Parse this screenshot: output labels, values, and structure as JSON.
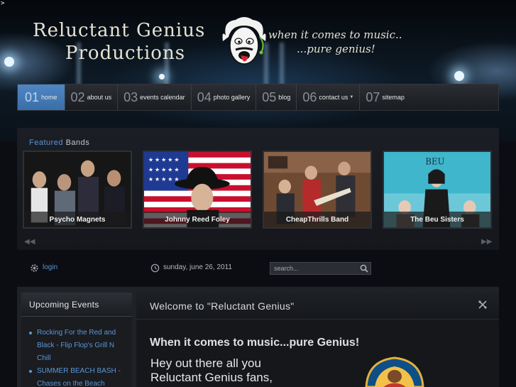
{
  "header": {
    "corner_mark": ">",
    "logo_line1": "Reluctant Genius",
    "logo_line2": "Productions",
    "tagline_line1": "when it comes to music..",
    "tagline_line2": "...pure genius!"
  },
  "nav": {
    "items": [
      {
        "num": "01",
        "label": "home",
        "active": true
      },
      {
        "num": "02",
        "label": "about us"
      },
      {
        "num": "03",
        "label": "events calendar"
      },
      {
        "num": "04",
        "label": "photo gallery"
      },
      {
        "num": "05",
        "label": "blog"
      },
      {
        "num": "06",
        "label": "contact us",
        "has_dropdown": true
      },
      {
        "num": "07",
        "label": "sitemap"
      }
    ]
  },
  "featured": {
    "heading_accent": "Featured",
    "heading_rest": " Bands",
    "bands": [
      {
        "name": "Psycho Magnets"
      },
      {
        "name": "Johnny Reed Foley"
      },
      {
        "name": "CheapThrills Band"
      },
      {
        "name": "The Beu Sisters",
        "sign": "BEU"
      }
    ],
    "prev_arrow": "◀◀",
    "next_arrow": "▶▶"
  },
  "utility": {
    "login_label": "login",
    "date": "sunday, june 26, 2011",
    "search_placeholder": "search..."
  },
  "sidebar": {
    "title": "Upcoming Events",
    "events": [
      {
        "title": "Rocking For the Red and Black - Flip Flop's Grill N Chill"
      },
      {
        "title": "SUMMER BEACH BASH - Chases on the Beach"
      }
    ]
  },
  "main": {
    "title": "Welcome to \"Reluctant Genius\"",
    "tagline": "When it comes to music...pure Genius!",
    "greeting_line1": "Hey out there all you",
    "greeting_line2": "Reluctant Genius fans,"
  },
  "colors": {
    "accent": "#5b96d6",
    "nav_active": "#4a80bf",
    "background": "#0b0d12"
  }
}
